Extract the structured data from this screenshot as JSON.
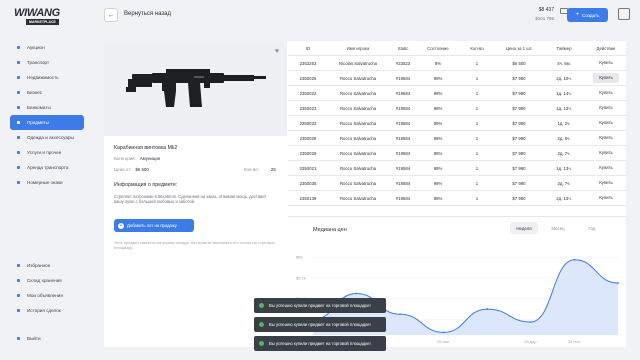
{
  "logo": {
    "main": "WIWANG",
    "sub": "MARKETPLACE"
  },
  "sidebar": {
    "items": [
      {
        "label": "Аукцион"
      },
      {
        "label": "Транспорт"
      },
      {
        "label": "Недвижимость"
      },
      {
        "label": "Бизнес"
      },
      {
        "label": "Банкоматы"
      },
      {
        "label": "Предметы",
        "active": true
      },
      {
        "label": "Одежда и аксессуары"
      },
      {
        "label": "Услуги и прочее"
      },
      {
        "label": "Аренда транспорта"
      },
      {
        "label": "Номерные знаки"
      }
    ],
    "bottom": [
      {
        "label": "Избранное"
      },
      {
        "label": "Склад хранения"
      },
      {
        "label": "Мои объявления"
      },
      {
        "label": "История сделок"
      }
    ],
    "logout": "Выйти"
  },
  "header": {
    "back_label": "Вернуться назад",
    "balance_main": "$8 437",
    "balance_sub": "$101 795",
    "create_label": "Создать"
  },
  "item": {
    "title": "Карабинная винтовка Mk2",
    "category_label": "Категория:",
    "category_value": "Амуниция",
    "price_label": "Цена от:",
    "price_value": "$6 500",
    "qty_label": "Кол-во:",
    "qty_value": "25",
    "desc_heading": "Информация о предмете:",
    "desc_text": "Стреляет патронами 5.56x45mm. Сделанная на заказ, отжимая мощь, доставит вашу пулю с большей любовью и заботой.",
    "add_button": "Добавить лот на продажу",
    "note": "Этот предмет имеется на вашем складе. Вы можете выставить его лотом на торговую площадку."
  },
  "table": {
    "headers": [
      "ID",
      "Имя игрока",
      "Static",
      "Состояние",
      "Кол-во",
      "Цена за 1 шт.",
      "Таймер",
      "Действие"
    ],
    "rows": [
      {
        "id": "2353263",
        "name": "Nicolas Salvatrucha",
        "static": "#23523",
        "state": "8%",
        "qty": "1",
        "price": "$6 500",
        "timer": "4ч. 6м.",
        "action": "Купить"
      },
      {
        "id": "2350026",
        "name": "Rocco Salvatrucha",
        "static": "#19584",
        "state": "99%",
        "qty": "1",
        "price": "$7 990",
        "timer": "2д. 10ч.",
        "action": "Купить",
        "hl": true
      },
      {
        "id": "2350022",
        "name": "Rocco Salvatrucha",
        "static": "#19584",
        "state": "98%",
        "qty": "1",
        "price": "$7 990",
        "timer": "1д. 14ч.",
        "action": "Купить"
      },
      {
        "id": "2350023",
        "name": "Rocco Salvatrucha",
        "static": "#19584",
        "state": "98%",
        "qty": "1",
        "price": "$7 990",
        "timer": "1д. 13ч.",
        "action": "Купить"
      },
      {
        "id": "2350033",
        "name": "Rocco Salvatrucha",
        "static": "#19584",
        "state": "98%",
        "qty": "1",
        "price": "$7 990",
        "timer": "1д. 2ч.",
        "action": "Купить"
      },
      {
        "id": "2350028",
        "name": "Rocco Salvatrucha",
        "static": "#19584",
        "state": "98%",
        "qty": "1",
        "price": "$7 990",
        "timer": "2д. 6ч.",
        "action": "Купить"
      },
      {
        "id": "2350029",
        "name": "Rocco Salvatrucha",
        "static": "#19584",
        "state": "98%",
        "qty": "1",
        "price": "$7 990",
        "timer": "2д. 7ч.",
        "action": "Купить"
      },
      {
        "id": "2350021",
        "name": "Rocco Salvatrucha",
        "static": "#19584",
        "state": "98%",
        "qty": "1",
        "price": "$7 990",
        "timer": "1д. 13ч.",
        "action": "Купить"
      },
      {
        "id": "2350035",
        "name": "Rocco Salvatrucha",
        "static": "#19584",
        "state": "98%",
        "qty": "1",
        "price": "$7 990",
        "timer": "2д. 7ч.",
        "action": "Купить"
      },
      {
        "id": "2350139",
        "name": "Rocco Salvatrucha",
        "static": "#19584",
        "state": "98%",
        "qty": "1",
        "price": "$7 990",
        "timer": "2д. 13ч.",
        "action": "Купить"
      }
    ]
  },
  "chart": {
    "title": "Медиана цен",
    "tabs": [
      "Неделя",
      "Месяц",
      "Год"
    ]
  },
  "chart_data": {
    "type": "area",
    "x": [
      "01 Mar",
      "",
      "",
      "29 пол.",
      "",
      "28 дор.",
      "28 пол.",
      ""
    ],
    "values": [
      3.6,
      4.6,
      3.8,
      3.1,
      4.0,
      3.5,
      5.9,
      5.0
    ],
    "yticks": [
      "$6k",
      "$5.2k",
      "$4.4k",
      "$3.6k"
    ],
    "ylim": [
      3.0,
      6.2
    ],
    "line_color": "#3d7be8",
    "fill_color": "#dce7fb"
  },
  "toasts": [
    "Вы успешно купили предмет на торговой площадке!",
    "Вы успешно купили предмет на торговой площадке!",
    "Вы успешно купили предмет на торговой площадке!"
  ]
}
